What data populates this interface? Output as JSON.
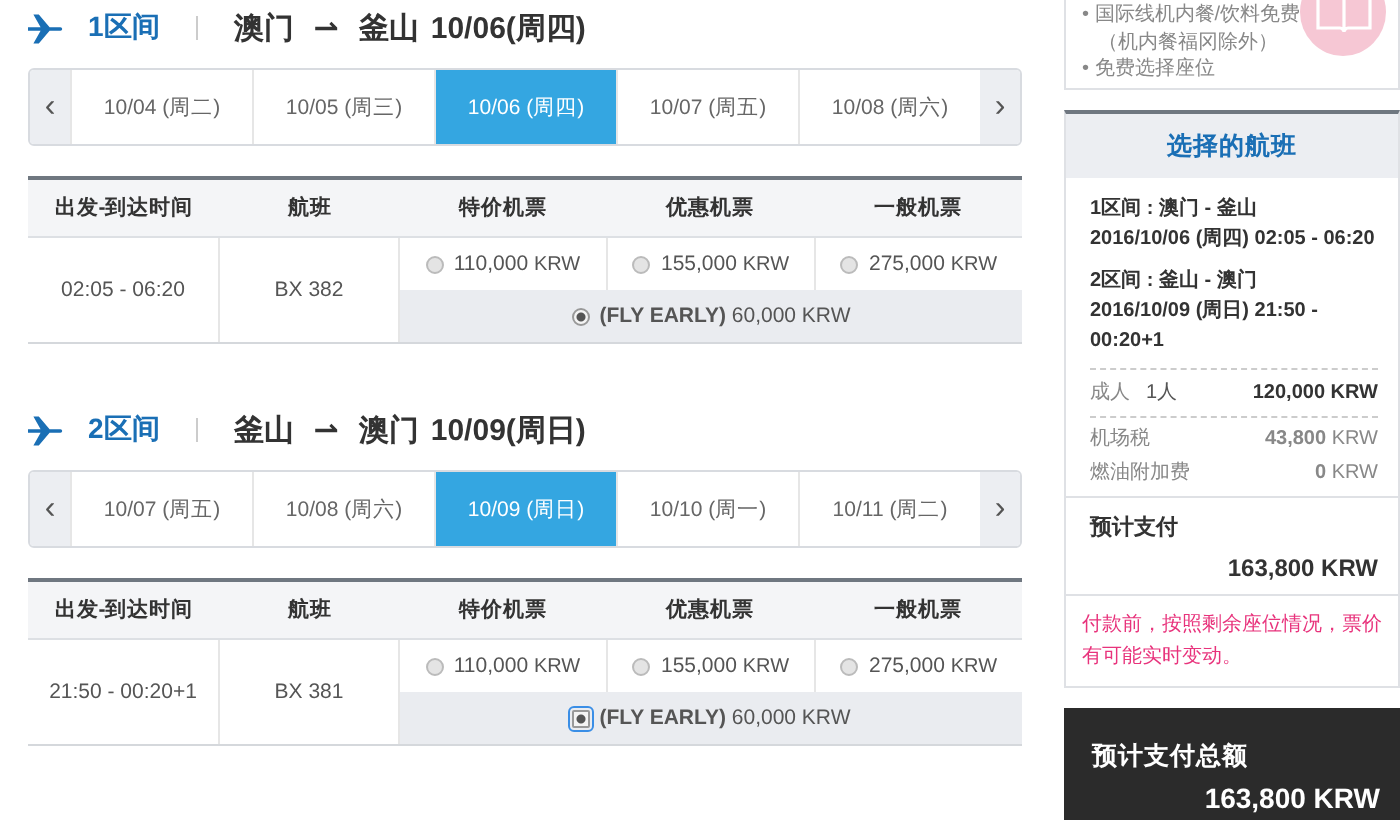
{
  "legs": [
    {
      "label": "1区间",
      "from": "澳门",
      "arrow": "⇀",
      "to": "釜山",
      "date": "10/06(周四)",
      "prev": "‹",
      "next": "›",
      "dates": [
        {
          "label": "10/04 (周二)",
          "selected": false
        },
        {
          "label": "10/05 (周三)",
          "selected": false
        },
        {
          "label": "10/06 (周四)",
          "selected": true
        },
        {
          "label": "10/07 (周五)",
          "selected": false
        },
        {
          "label": "10/08 (周六)",
          "selected": false
        }
      ],
      "columns": [
        "出发-到达时间",
        "航班",
        "特价机票",
        "优惠机票",
        "一般机票"
      ],
      "flight": {
        "time": "02:05 - 06:20",
        "number": "BX 382",
        "fares": [
          {
            "price": "110,000",
            "currency": "KRW",
            "selected": false
          },
          {
            "price": "155,000",
            "currency": "KRW",
            "selected": false
          },
          {
            "price": "275,000",
            "currency": "KRW",
            "selected": false
          }
        ],
        "special": {
          "text": "**(FLY EARLY)** 60,000 KRW",
          "selected": true
        }
      }
    },
    {
      "label": "2区间",
      "from": "釜山",
      "arrow": "⇀",
      "to": "澳门",
      "date": "10/09(周日)",
      "prev": "‹",
      "next": "›",
      "dates": [
        {
          "label": "10/07 (周五)",
          "selected": false
        },
        {
          "label": "10/08 (周六)",
          "selected": false
        },
        {
          "label": "10/09 (周日)",
          "selected": true
        },
        {
          "label": "10/10 (周一)",
          "selected": false
        },
        {
          "label": "10/11 (周二)",
          "selected": false
        }
      ],
      "columns": [
        "出发-到达时间",
        "航班",
        "特价机票",
        "优惠机票",
        "一般机票"
      ],
      "flight": {
        "time": "21:50 - 00:20+1",
        "number": "BX 381",
        "fares": [
          {
            "price": "110,000",
            "currency": "KRW",
            "selected": false
          },
          {
            "price": "155,000",
            "currency": "KRW",
            "selected": false
          },
          {
            "price": "275,000",
            "currency": "KRW",
            "selected": false
          }
        ],
        "special": {
          "text": "**(FLY EARLY)** 60,000 KRW",
          "selected": true
        }
      }
    }
  ],
  "benefits": [
    "• 国际线机内餐/饮料免费",
    "（机内餐福冈除外）",
    "• 免费选择座位"
  ],
  "summary": {
    "title": "选择的航班",
    "legs": [
      {
        "route": "1区间 : 澳门 - 釜山",
        "schedule": "2016/10/06 (周四) 02:05 - 06:20"
      },
      {
        "route": "2区间 : 釜山 - 澳门",
        "schedule": "2016/10/09 (周日) 21:50 - 00:20+1"
      }
    ],
    "passenger": {
      "label": "成人",
      "count": "1人",
      "amount": "120,000 KRW"
    },
    "fees": [
      {
        "label": "机场税",
        "amount": "**43,800** KRW"
      },
      {
        "label": "燃油附加费",
        "amount": "**0** KRW"
      }
    ],
    "estimate_label": "预计支付",
    "estimate": "163,800 KRW",
    "notice": "付款前，按照剩余座位情况，票价有可能实时变动。",
    "total_label": "预计支付总额",
    "total": "163,800 KRW"
  }
}
